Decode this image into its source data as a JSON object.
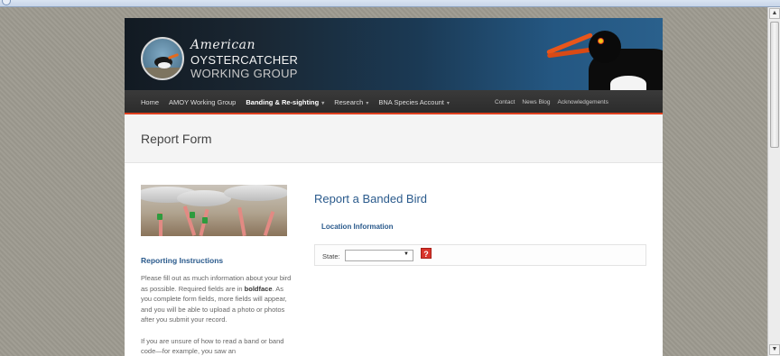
{
  "site": {
    "logo_line1": "American",
    "logo_line2": "OYSTERCATCHER",
    "logo_line3": "WORKING GROUP"
  },
  "nav": {
    "left": [
      {
        "label": "Home",
        "dropdown": false,
        "active": false
      },
      {
        "label": "AMOY Working Group",
        "dropdown": false,
        "active": false
      },
      {
        "label": "Banding & Re-sighting",
        "dropdown": true,
        "active": true
      },
      {
        "label": "Research",
        "dropdown": true,
        "active": false
      },
      {
        "label": "BNA Species Account",
        "dropdown": true,
        "active": false
      }
    ],
    "right": [
      "Contact",
      "News Blog",
      "Acknowledgements"
    ],
    "caret": "▾",
    "accent_color": "#e0401f"
  },
  "page": {
    "title": "Report Form"
  },
  "sidebar": {
    "heading": "Reporting Instructions",
    "para1_a": "Please fill out as much information about your bird as possible. Required fields are in ",
    "para1_bold": "boldface",
    "para1_b": ". As you complete form fields, more fields will appear, and you will be able to upload a photo or photos after you submit your record.",
    "para2": "If you are unsure of how to read a band or band code—for example, you saw an"
  },
  "form": {
    "title": "Report a Banded Bird",
    "section": "Location Information",
    "state_label": "State:",
    "state_value": "",
    "help_label": "?",
    "heading_color": "#2a5a8c"
  },
  "icons": {
    "help": "help-icon",
    "scroll_up": "scroll-up-arrow-icon",
    "scroll_down": "scroll-down-arrow-icon"
  }
}
